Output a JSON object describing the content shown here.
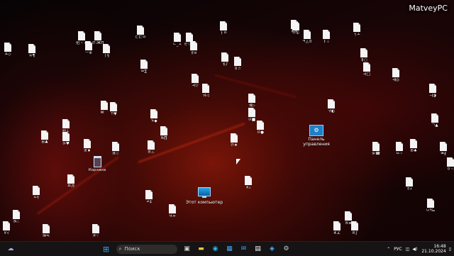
{
  "watermark": "MatveyPC",
  "desktop": {
    "special_icons": {
      "control_panel": {
        "label": "Панель управления"
      },
      "this_pc": {
        "label": "Этот компьютер"
      },
      "recycle_bin": {
        "label": "Корзина"
      }
    },
    "files": [
      {
        "label": "㐶・ㅊ"
      },
      {
        "label": "ㄹ:ЖП"
      },
      {
        "label": "ㄷ亡ㅁ"
      },
      {
        "label": "ㄴ_ㅅ"
      },
      {
        "label": "ㅌ♡ㅂ"
      },
      {
        "label": "ㅏㅁ"
      },
      {
        "label": "ㅈ①"
      },
      {
        "label": "ㅋ△ㅍ"
      },
      {
        "label": "ㅑ♤"
      },
      {
        "label": "ㅓㅗ"
      },
      {
        "label": "ㅛ◇"
      },
      {
        "label": "ㅠ¶"
      },
      {
        "label": "ㅡ※"
      },
      {
        "label": "ㅣ§"
      },
      {
        "label": "ㅐ¤"
      },
      {
        "label": "ㅔ♪"
      },
      {
        "label": "ㅒ☆"
      },
      {
        "label": "ㅖ○"
      },
      {
        "label": "ㅘ□"
      },
      {
        "label": "ㅙ◎"
      },
      {
        "label": "ㅚ▽"
      },
      {
        "label": "ㅝ◁"
      },
      {
        "label": "ㅞ▷"
      },
      {
        "label": "ㅟ◐"
      },
      {
        "label": "ㅢ◑"
      },
      {
        "label": "ㄱ▲"
      },
      {
        "label": "ㄲ▼"
      },
      {
        "label": "ㄳ◆"
      },
      {
        "label": "ㄵ■"
      },
      {
        "label": "ㄶ●"
      },
      {
        "label": "ㄺ★"
      },
      {
        "label": "ㄻ♠"
      },
      {
        "label": "ㄼ♣"
      },
      {
        "label": "ㄽ♥"
      },
      {
        "label": "ㄾ♦"
      },
      {
        "label": "ㄿ♧"
      },
      {
        "label": "ㅀ♨"
      },
      {
        "label": "ㅄ☎"
      },
      {
        "label": "ㅆ☞"
      },
      {
        "label": "ㅇ☜"
      },
      {
        "label": "ㅉ♬"
      },
      {
        "label": "ㅊ♭"
      },
      {
        "label": "ㅎ♯"
      },
      {
        "label": "ㅥ†"
      },
      {
        "label": "ㅦ‡"
      },
      {
        "label": "ㅧ‰"
      },
      {
        "label": "ㅨ∞"
      },
      {
        "label": "ㅩ∴"
      },
      {
        "label": "ㅪ∵"
      },
      {
        "label": "ㅫ≒"
      },
      {
        "label": "ㅬ≡"
      },
      {
        "label": "ㅭ∫"
      },
      {
        "label": "ㅮ∮"
      },
      {
        "label": "ㅯ∑"
      },
      {
        "label": "ㅰ∏"
      },
      {
        "label": "ㅱ√"
      },
      {
        "label": "ㅲ∝"
      },
      {
        "label": "ㅳ∠"
      },
      {
        "label": "ㅴ⊥"
      },
      {
        "label": "ㅵ⌒"
      }
    ]
  },
  "taskbar": {
    "search_placeholder": "Поиск",
    "language": "РУС",
    "time": "16:48",
    "date": "21.10.2024"
  },
  "colors": {
    "taskbar_bg": "#151313",
    "accent": "#1f7fc7"
  }
}
